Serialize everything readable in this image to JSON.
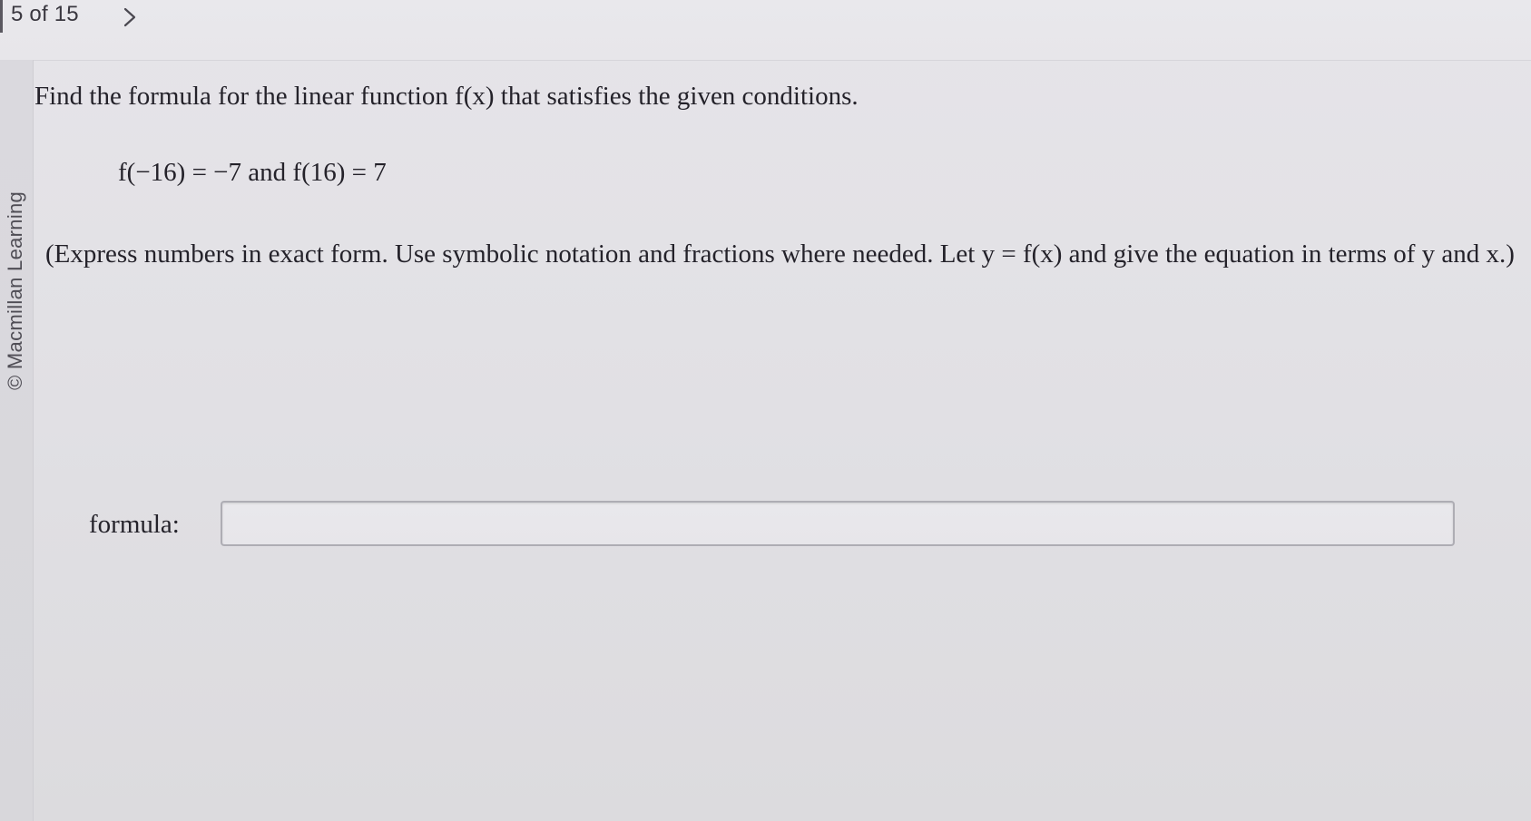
{
  "nav": {
    "counter": "5 of 15"
  },
  "sidebar": {
    "copyright": "© Macmillan Learning"
  },
  "question": {
    "prompt": "Find the formula for the linear function f(x) that satisfies the given conditions.",
    "conditions": "f(−16) = −7 and f(16) = 7",
    "instructions": "(Express numbers in exact form. Use symbolic notation and fractions where needed. Let y = f(x) and give the equation in terms of y and x.)"
  },
  "answer": {
    "label": "formula:",
    "value": "",
    "placeholder": ""
  },
  "colors": {
    "background": "#e2e1e5",
    "text": "#24222a",
    "input_border": "#aeadb4"
  },
  "icons": {
    "next": "chevron-right-icon"
  }
}
